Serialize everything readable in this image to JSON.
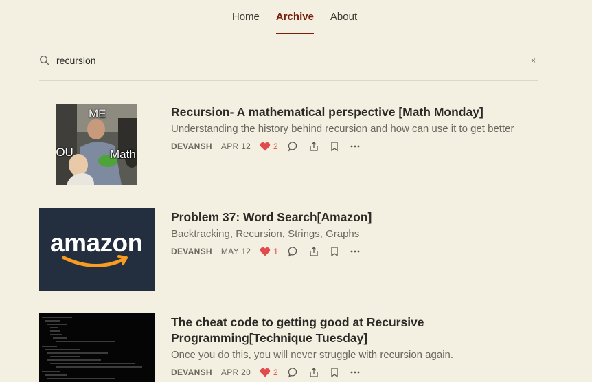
{
  "nav": {
    "tabs": [
      {
        "label": "Home"
      },
      {
        "label": "Archive"
      },
      {
        "label": "About"
      }
    ]
  },
  "search": {
    "value": "recursion",
    "clear_label": "×"
  },
  "posts": [
    {
      "title": "Recursion- A mathematical perspective [Math Monday]",
      "subtitle": "Understanding the history behind recursion and how can use it to get better",
      "author": "DEVANSH",
      "date": "APR 12",
      "likes": "2",
      "thumb": {
        "top_text": "ME",
        "left_text": "YOU",
        "right_text": "Math"
      }
    },
    {
      "title": "Problem 37: Word Search[Amazon]",
      "subtitle": "Backtracking, Recursion, Strings, Graphs",
      "author": "DEVANSH",
      "date": "MAY 12",
      "likes": "1",
      "thumb": {
        "logo_text": "amazon"
      }
    },
    {
      "title_line1": "The cheat code to getting good at Recursive",
      "title_line2": "Programming[Technique Tuesday]",
      "subtitle": "Once you do this, you will never struggle with recursion again.",
      "author": "DEVANSH",
      "date": "APR 20",
      "likes": "2"
    }
  ],
  "colors": {
    "background": "#f3f0e1",
    "accent": "#7a1f0e",
    "heart": "#e24b4b",
    "amazon_bg": "#232f3e",
    "amazon_smile": "#f79c20"
  }
}
